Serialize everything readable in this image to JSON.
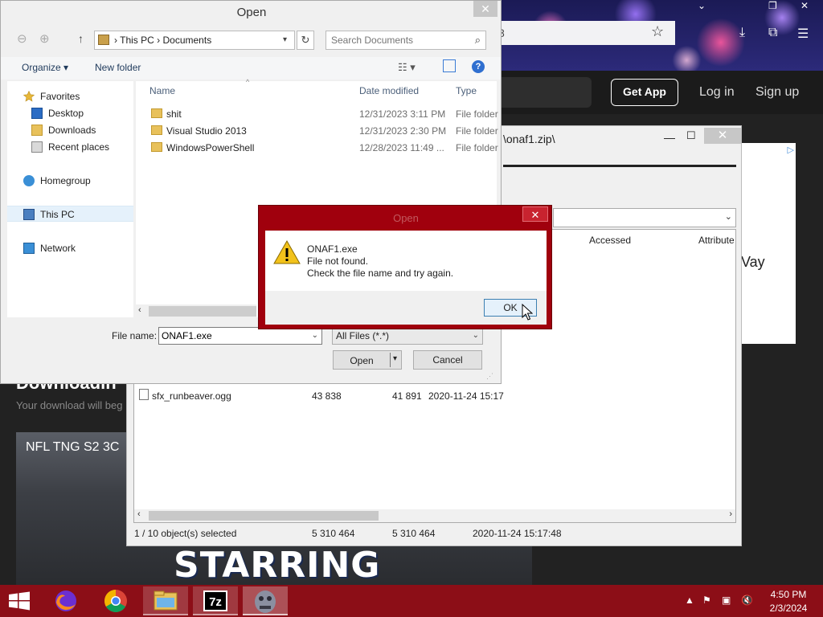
{
  "browser": {
    "address_fragment": "8",
    "get_app": "Get App",
    "login": "Log in",
    "signup": "Sign up",
    "page_heading": "Downloadin",
    "page_subtext": "Your download will beg",
    "video_title": "NFL TNG S2 3C",
    "video_overlay": "STARRING",
    "ad_text": "Vay"
  },
  "zip_window": {
    "title": "\\onaf1.zip\\",
    "columns": {
      "accessed": "Accessed",
      "attributes": "Attribute"
    },
    "row": {
      "name": "sfx_runbeaver.ogg",
      "size": "43 838",
      "packed": "41 891",
      "modified": "2020-11-24 15:17"
    },
    "status": {
      "selection": "1 / 10 object(s) selected",
      "size": "5 310 464",
      "packed": "5 310 464",
      "modified": "2020-11-24 15:17:48"
    }
  },
  "open_dialog": {
    "title": "Open",
    "breadcrumb": [
      "This PC",
      "Documents"
    ],
    "breadcrumb_sep": "›",
    "search_placeholder": "Search Documents",
    "toolbar": {
      "organize": "Organize ▾",
      "new_folder": "New folder"
    },
    "nav": {
      "favorites": "Favorites",
      "desktop": "Desktop",
      "downloads": "Downloads",
      "recent": "Recent places",
      "homegroup": "Homegroup",
      "this_pc": "This PC",
      "network": "Network"
    },
    "columns": {
      "name": "Name",
      "date": "Date modified",
      "type": "Type"
    },
    "files": [
      {
        "name": "shit",
        "date": "12/31/2023 3:11 PM",
        "type": "File folder"
      },
      {
        "name": "Visual Studio 2013",
        "date": "12/31/2023 2:30 PM",
        "type": "File folder"
      },
      {
        "name": "WindowsPowerShell",
        "date": "12/28/2023 11:49 ...",
        "type": "File folder"
      }
    ],
    "filename_label": "File name:",
    "filename_value": "ONAF1.exe",
    "filetype_value": "All Files (*.*)",
    "open_label": "Open",
    "cancel_label": "Cancel"
  },
  "error_box": {
    "title": "Open",
    "file": "ONAF1.exe",
    "line1": "File not found.",
    "line2": "Check the file name and try again.",
    "ok": "OK"
  },
  "taskbar": {
    "time": "4:50 PM",
    "date": "2/3/2024",
    "apps": [
      "firefox-icon",
      "chrome-icon",
      "file-explorer-icon",
      "7zip-icon",
      "app-icon"
    ]
  },
  "colors": {
    "taskbar": "#8c0e17",
    "error_frame": "#a0000d",
    "selection": "#e5f1fb"
  }
}
